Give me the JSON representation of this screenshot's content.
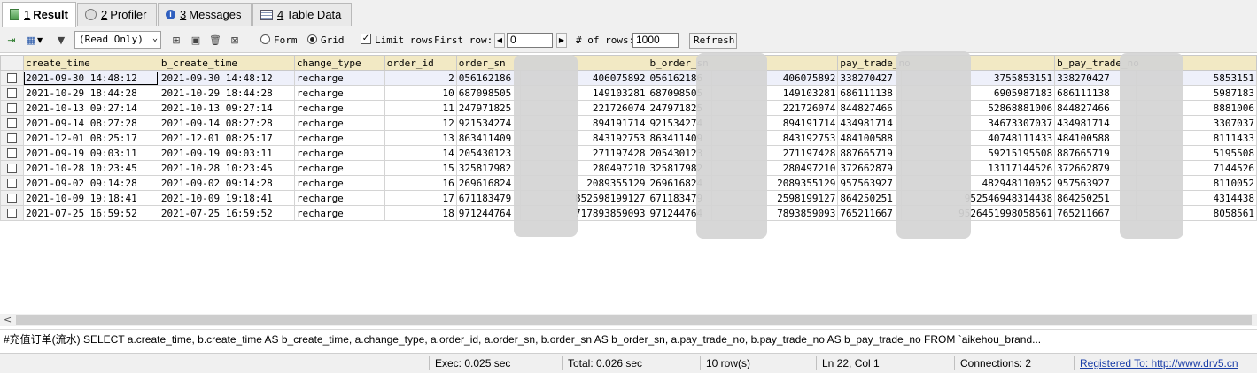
{
  "tabs": [
    {
      "num": "1",
      "label": "Result",
      "icon": "result-grid-icon",
      "active": true
    },
    {
      "num": "2",
      "label": "Profiler",
      "icon": "profiler-icon",
      "active": false
    },
    {
      "num": "3",
      "label": "Messages",
      "icon": "info-icon",
      "active": false
    },
    {
      "num": "4",
      "label": "Table Data",
      "icon": "table-icon",
      "active": false
    }
  ],
  "toolbar": {
    "mode_select": "(Read Only)",
    "form_label": "Form",
    "grid_label": "Grid",
    "limit_rows_label": "Limit rows",
    "first_row_label": "First row:",
    "first_row_value": "0",
    "num_rows_label": "# of rows:",
    "num_rows_value": "1000",
    "refresh_label": "Refresh"
  },
  "grid": {
    "columns": [
      "create_time",
      "b_create_time",
      "change_type",
      "order_id",
      "order_sn",
      "b_order_sn",
      "pay_trade_no",
      "b_pay_trade_no"
    ],
    "rows": [
      [
        "2021-09-30 14:48:12",
        "2021-09-30 14:48:12",
        "recharge",
        "2",
        "056162186",
        "406075892",
        "056162186",
        "406075892",
        "338270427",
        "3755853151",
        "338270427",
        "5853151"
      ],
      [
        "2021-10-29 18:44:28",
        "2021-10-29 18:44:28",
        "recharge",
        "10",
        "687098505",
        "149103281",
        "687098505",
        "149103281",
        "686111138",
        "6905987183",
        "686111138",
        "5987183"
      ],
      [
        "2021-10-13 09:27:14",
        "2021-10-13 09:27:14",
        "recharge",
        "11",
        "247971825",
        "221726074",
        "247971825",
        "221726074",
        "844827466",
        "52868881006",
        "844827466",
        "8881006"
      ],
      [
        "2021-09-14 08:27:28",
        "2021-09-14 08:27:28",
        "recharge",
        "12",
        "921534274",
        "894191714",
        "921534274",
        "894191714",
        "434981714",
        "34673307037",
        "434981714",
        "3307037"
      ],
      [
        "2021-12-01 08:25:17",
        "2021-12-01 08:25:17",
        "recharge",
        "13",
        "863411409",
        "843192753",
        "863411409",
        "843192753",
        "484100588",
        "40748111433",
        "484100588",
        "8111433"
      ],
      [
        "2021-09-19 09:03:11",
        "2021-09-19 09:03:11",
        "recharge",
        "14",
        "205430123",
        "271197428",
        "205430123",
        "271197428",
        "887665719",
        "59215195508",
        "887665719",
        "5195508"
      ],
      [
        "2021-10-28 10:23:45",
        "2021-10-28 10:23:45",
        "recharge",
        "15",
        "325817982",
        "280497210",
        "325817982",
        "280497210",
        "372662879",
        "13117144526",
        "372662879",
        "7144526"
      ],
      [
        "2021-09-02 09:14:28",
        "2021-09-02 09:14:28",
        "recharge",
        "16",
        "269616824",
        "2089355129",
        "269616824",
        "2089355129",
        "957563927",
        "482948110052",
        "957563927",
        "8110052"
      ],
      [
        "2021-10-09 19:18:41",
        "2021-10-09 19:18:41",
        "recharge",
        "17",
        "671183479",
        "852598199127",
        "671183479",
        "2598199127",
        "864250251",
        "952546948314438",
        "864250251",
        "4314438"
      ],
      [
        "2021-07-25 16:59:52",
        "2021-07-25 16:59:52",
        "recharge",
        "18",
        "971244764",
        "717893859093",
        "971244764",
        "7893859093",
        "765211667",
        "9526451998058561",
        "765211667",
        "8058561"
      ]
    ]
  },
  "query": "#充值订单(流水) SELECT a.create_time, b.create_time AS b_create_time, a.change_type, a.order_id, a.order_sn, b.order_sn AS b_order_sn, a.pay_trade_no, b.pay_trade_no AS b_pay_trade_no FROM `aikehou_brand...",
  "status": {
    "exec": "Exec: 0.025 sec",
    "total": "Total: 0.026 sec",
    "rows": "10 row(s)",
    "position": "Ln 22, Col 1",
    "connections": "Connections: 2",
    "registered": "Registered To: http://www.drv5.cn"
  }
}
